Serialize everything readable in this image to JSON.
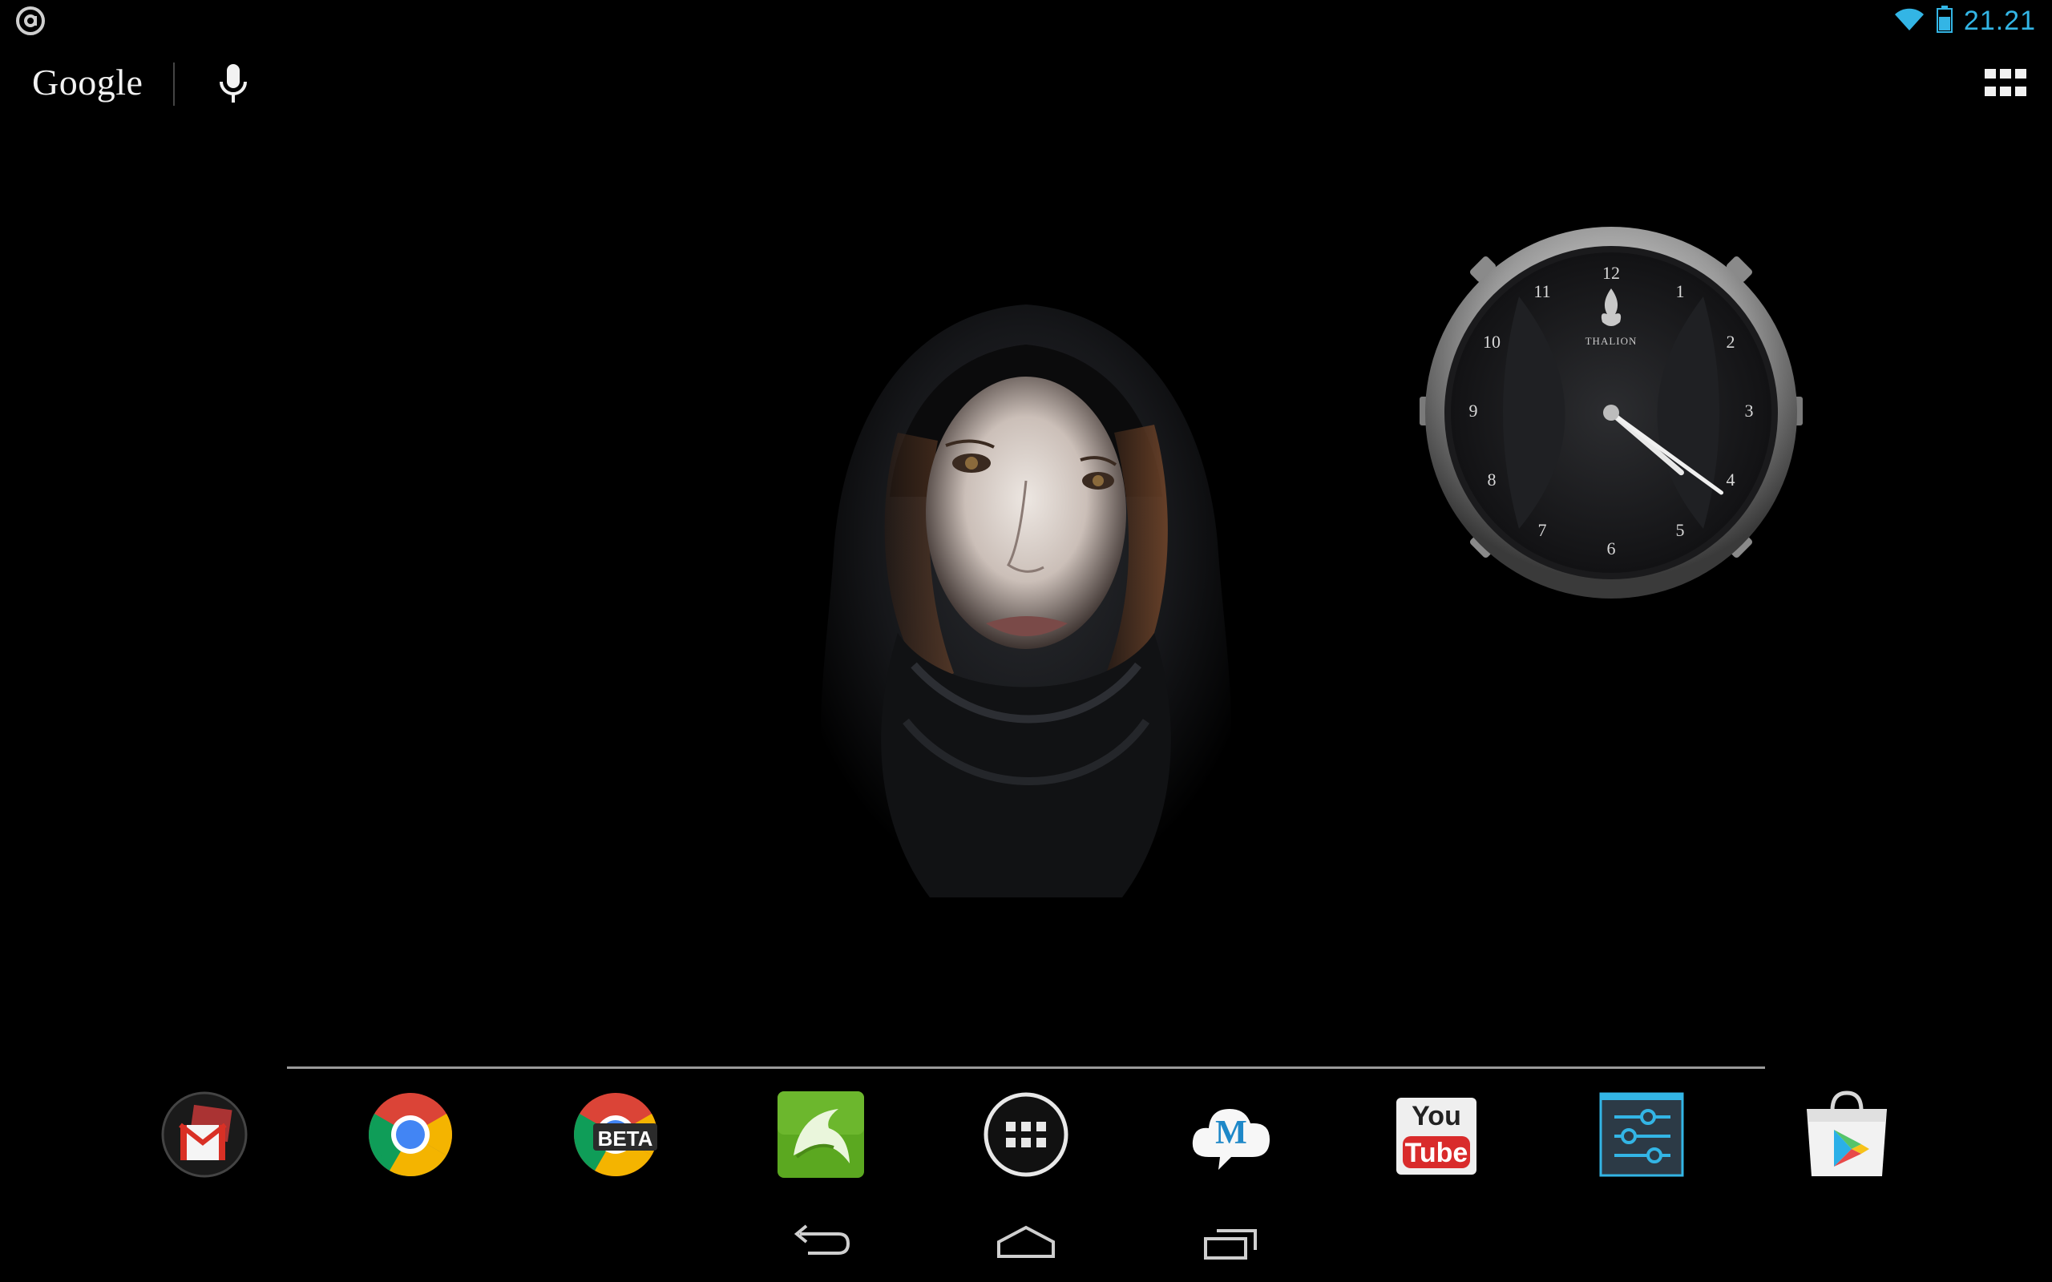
{
  "status_bar": {
    "time": "21.21",
    "icons": [
      "notification-icon",
      "wifi-icon",
      "battery-icon"
    ],
    "accent_color": "#33b5e5"
  },
  "search": {
    "logo_text": "Google",
    "icons": [
      "mic-icon"
    ]
  },
  "toolbar": {
    "icons": [
      "apps-grid-icon"
    ]
  },
  "clock_widget": {
    "brand": "THALION",
    "numerals": [
      "12",
      "1",
      "2",
      "3",
      "4",
      "5",
      "6",
      "7",
      "8",
      "9",
      "10",
      "11"
    ],
    "hour_hand_hour": 4,
    "minute_hand_minute": 21
  },
  "dock": {
    "items": [
      {
        "name": "gmail",
        "icon": "gmail-icon"
      },
      {
        "name": "chrome",
        "icon": "chrome-icon"
      },
      {
        "name": "chrome-beta",
        "icon": "chrome-beta-icon",
        "badge": "BETA"
      },
      {
        "name": "dolphin-browser",
        "icon": "dolphin-icon"
      },
      {
        "name": "app-drawer",
        "icon": "app-drawer-icon"
      },
      {
        "name": "m-cloud",
        "icon": "m-cloud-icon",
        "letter": "M"
      },
      {
        "name": "youtube",
        "icon": "youtube-icon",
        "text_top": "You",
        "text_bottom": "Tube"
      },
      {
        "name": "settings",
        "icon": "settings-icon"
      },
      {
        "name": "play-store",
        "icon": "play-store-icon"
      }
    ]
  },
  "nav": {
    "icons": [
      "back-icon",
      "home-icon",
      "recent-apps-icon"
    ]
  }
}
